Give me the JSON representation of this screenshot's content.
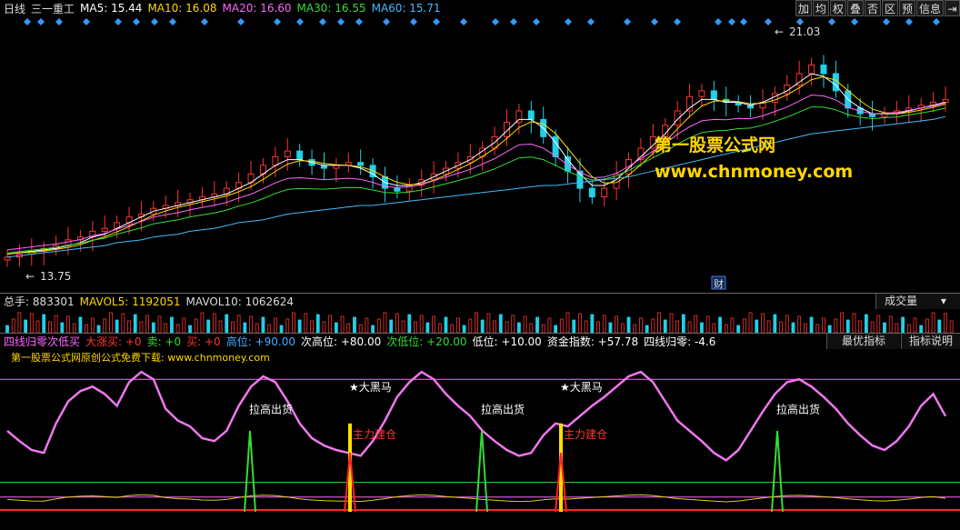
{
  "header": {
    "period": "日线",
    "stock": "三一重工",
    "ma": [
      {
        "label": "MA5: 15.44",
        "color": "#ffffff"
      },
      {
        "label": "MA10: 16.08",
        "color": "#ffd700"
      },
      {
        "label": "MA20: 16.60",
        "color": "#ff66ff"
      },
      {
        "label": "MA30: 16.55",
        "color": "#33dd33"
      },
      {
        "label": "MA60: 15.71",
        "color": "#44bbff"
      }
    ],
    "buttons": [
      "加",
      "均",
      "权",
      "叠",
      "否",
      "区",
      "预",
      "信息",
      "⇥"
    ]
  },
  "price_chart": {
    "high_label": "21.03",
    "low_label": "13.75",
    "cai_badge": "财",
    "watermark_line1": "第一股票公式网",
    "watermark_line2": "www.chnmoney.com"
  },
  "volume": {
    "total": "总手: 883301",
    "mavol5": "MAVOL5: 1192051",
    "mavol10": "MAVOL10: 1062624",
    "dropdown": "成交量"
  },
  "indicator": {
    "items": [
      {
        "label": "四线归零次低买",
        "color": "#ff66ff"
      },
      {
        "label": "大涨买: +0",
        "color": "#ff3333"
      },
      {
        "label": "卖: +0",
        "color": "#33dd33"
      },
      {
        "label": "买: +0",
        "color": "#ff3333"
      },
      {
        "label": "高位: +90.00",
        "color": "#44aaff"
      },
      {
        "label": "次高位: +80.00",
        "color": "#ffffff"
      },
      {
        "label": "次低位: +20.00",
        "color": "#33dd33"
      },
      {
        "label": "低位: +10.00",
        "color": "#ffffff"
      },
      {
        "label": "资金指数: +57.78",
        "color": "#ffffff"
      },
      {
        "label": "四线归零: -4.6",
        "color": "#ffffff"
      }
    ],
    "btn_best": "最优指标",
    "btn_desc": "指标说明",
    "subtitle": "第一股票公式网原创公式免费下载: www.chnmoney.com",
    "signals": [
      {
        "text": "拉高出货",
        "color": "#ffffff"
      },
      {
        "text": "★大黑马",
        "color": "#ffffff"
      },
      {
        "text": "主力建仓",
        "color": "#ff3333"
      },
      {
        "text": "拉高出货",
        "color": "#ffffff"
      },
      {
        "text": "★大黑马",
        "color": "#ffffff"
      },
      {
        "text": "主力建仓",
        "color": "#ff3333"
      },
      {
        "text": "拉高出货",
        "color": "#ffffff"
      }
    ]
  },
  "chart_data": {
    "type": "line",
    "ylim": [
      13.0,
      21.5
    ],
    "closes": [
      13.8,
      13.9,
      14.0,
      14.1,
      14.2,
      14.4,
      14.5,
      14.7,
      14.8,
      15.0,
      15.2,
      15.3,
      15.5,
      15.6,
      15.7,
      15.8,
      15.9,
      16.0,
      16.2,
      16.4,
      16.7,
      17.0,
      17.3,
      17.5,
      17.2,
      17.0,
      16.9,
      17.0,
      17.1,
      17.0,
      16.6,
      16.2,
      16.1,
      16.3,
      16.5,
      16.7,
      16.9,
      17.1,
      17.3,
      17.6,
      18.0,
      18.5,
      18.9,
      18.6,
      18.0,
      17.3,
      16.8,
      16.2,
      15.9,
      16.2,
      16.7,
      17.2,
      17.6,
      18.0,
      18.4,
      18.9,
      19.4,
      19.6,
      19.3,
      19.2,
      19.1,
      19.0,
      19.2,
      19.5,
      19.8,
      20.2,
      20.5,
      20.2,
      19.6,
      19.0,
      18.8,
      18.7,
      18.8,
      18.9,
      19.0,
      19.1,
      19.2,
      19.3
    ],
    "ma5": [
      13.9,
      13.95,
      14.0,
      14.05,
      14.1,
      14.2,
      14.3,
      14.5,
      14.6,
      14.8,
      15.0,
      15.2,
      15.4,
      15.5,
      15.6,
      15.7,
      15.8,
      15.9,
      16.0,
      16.2,
      16.4,
      16.7,
      17.0,
      17.2,
      17.2,
      17.1,
      17.0,
      17.0,
      17.0,
      16.9,
      16.7,
      16.4,
      16.3,
      16.3,
      16.4,
      16.6,
      16.8,
      17.0,
      17.2,
      17.5,
      17.8,
      18.2,
      18.6,
      18.6,
      18.3,
      17.8,
      17.2,
      16.7,
      16.3,
      16.3,
      16.5,
      16.9,
      17.3,
      17.7,
      18.1,
      18.6,
      19.0,
      19.3,
      19.3,
      19.2,
      19.2,
      19.1,
      19.2,
      19.4,
      19.6,
      19.9,
      20.2,
      20.1,
      19.8,
      19.3,
      19.0,
      18.8,
      18.8,
      18.8,
      18.9,
      19.0,
      19.1,
      19.2
    ],
    "ma60": [
      13.8,
      13.85,
      13.9,
      13.95,
      14.0,
      14.05,
      14.1,
      14.15,
      14.2,
      14.3,
      14.35,
      14.4,
      14.5,
      14.55,
      14.6,
      14.7,
      14.75,
      14.8,
      14.9,
      15.0,
      15.05,
      15.1,
      15.2,
      15.3,
      15.35,
      15.4,
      15.45,
      15.5,
      15.55,
      15.6,
      15.6,
      15.65,
      15.7,
      15.75,
      15.8,
      15.85,
      15.9,
      15.95,
      16.0,
      16.05,
      16.1,
      16.15,
      16.2,
      16.25,
      16.3,
      16.3,
      16.35,
      16.4,
      16.45,
      16.5,
      16.55,
      16.6,
      16.7,
      16.8,
      16.9,
      17.0,
      17.1,
      17.2,
      17.3,
      17.4,
      17.5,
      17.6,
      17.7,
      17.8,
      17.9,
      18.0,
      18.1,
      18.15,
      18.2,
      18.25,
      18.3,
      18.35,
      18.4,
      18.45,
      18.5,
      18.55,
      18.6,
      18.7
    ],
    "oscillator": [
      55,
      48,
      42,
      40,
      60,
      75,
      82,
      85,
      80,
      72,
      88,
      95,
      90,
      70,
      62,
      58,
      50,
      48,
      55,
      72,
      85,
      92,
      88,
      75,
      60,
      50,
      45,
      42,
      40,
      38,
      48,
      62,
      78,
      88,
      95,
      90,
      80,
      72,
      65,
      55,
      48,
      42,
      38,
      40,
      52,
      60,
      58,
      65,
      72,
      78,
      85,
      92,
      95,
      88,
      75,
      62,
      55,
      48,
      40,
      35,
      42,
      55,
      68,
      80,
      88,
      90,
      85,
      78,
      70,
      60,
      52,
      45,
      42,
      48,
      58,
      72,
      80,
      65
    ],
    "xlabel": "",
    "ylabel": ""
  }
}
